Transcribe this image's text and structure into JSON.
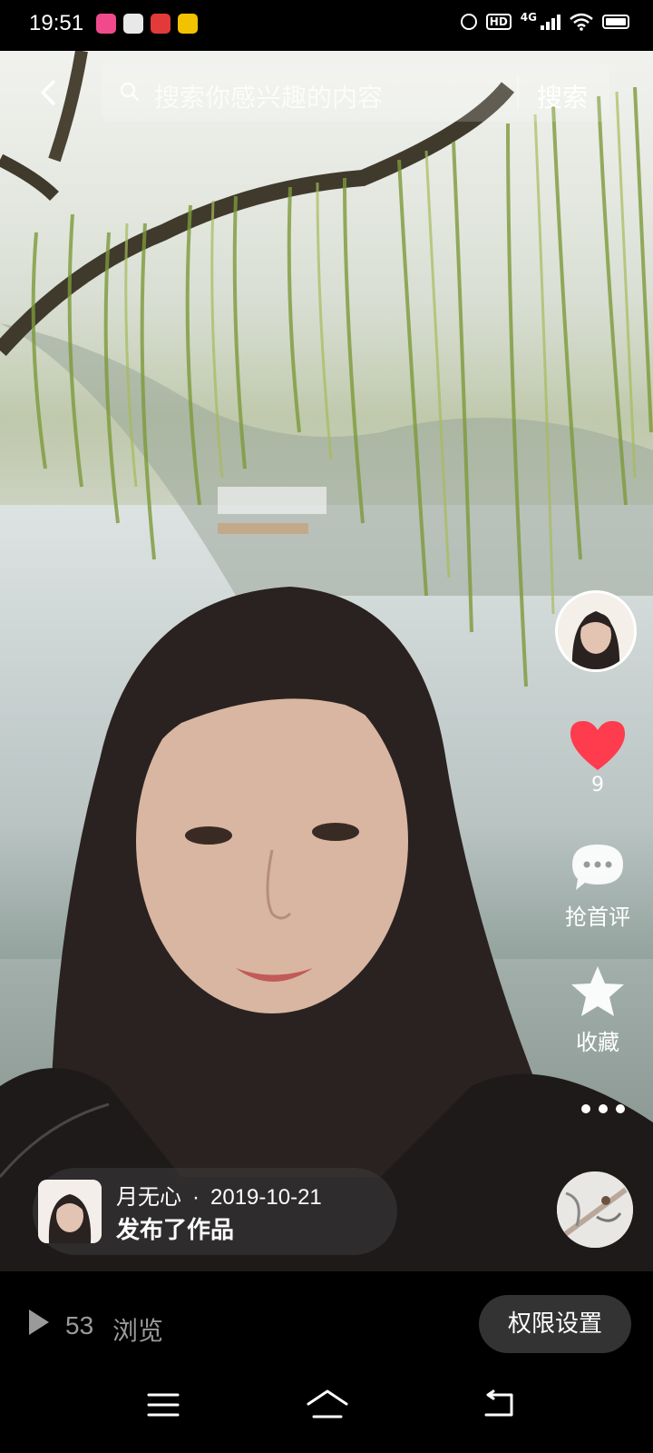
{
  "status_bar": {
    "time": "19:51",
    "network": "4G",
    "icons": [
      "alarm-icon",
      "hd-icon",
      "signal-icon",
      "wifi-icon",
      "battery-icon"
    ]
  },
  "search": {
    "placeholder": "搜索你感兴趣的内容",
    "button_label": "搜索"
  },
  "actions": {
    "like_count": "9",
    "comment_label": "抢首评",
    "favorite_label": "收藏"
  },
  "post": {
    "author": "月无心",
    "separator": "·",
    "date": "2019-10-21",
    "action_text": "发布了作品"
  },
  "bottom": {
    "views_count": "53",
    "views_label": "浏览",
    "permission_button": "权限设置"
  },
  "colors": {
    "like_red": "#ff3b4e",
    "background": "#000000",
    "button_bg": "#333333"
  }
}
